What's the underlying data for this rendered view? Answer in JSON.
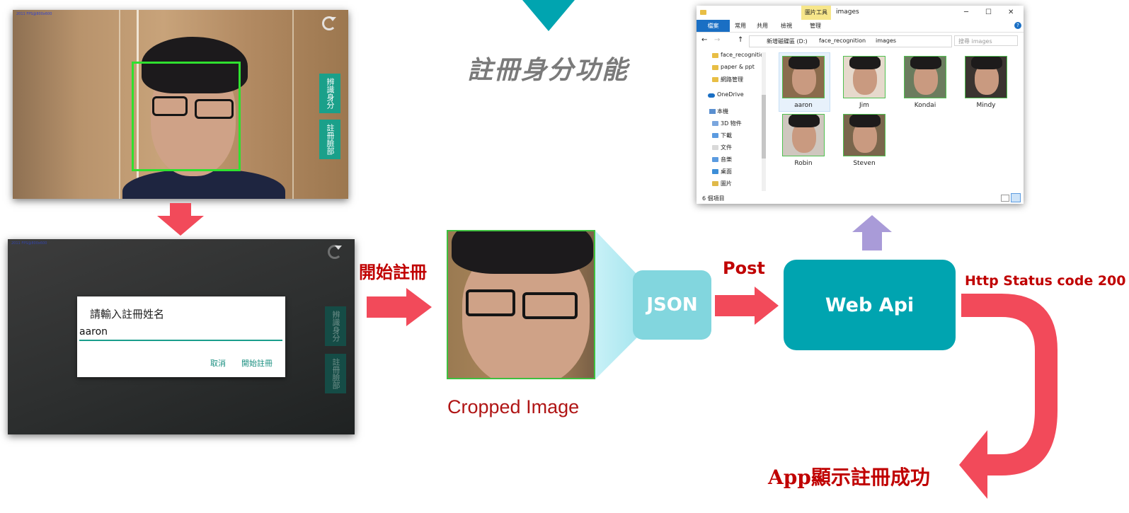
{
  "title": "註冊身分功能",
  "camera_view": {
    "overlay_text": "2011 FPS@800x600",
    "side_buttons": [
      "辨識身分",
      "註冊臉部"
    ]
  },
  "register_dialog": {
    "overlay_text": "2011 FPS@800x600",
    "title": "請輸入註冊姓名",
    "input_value": "aaron",
    "cancel_label": "取消",
    "confirm_label": "開始註冊",
    "side_buttons": [
      "辨識身分",
      "註冊臉部"
    ]
  },
  "labels": {
    "start_register": "開始註冊",
    "cropped_image": "Cropped Image",
    "json": "JSON",
    "post": "Post",
    "web_api": "Web Api",
    "http_status": "Http Status code 200",
    "app_success": "App顯示註冊成功"
  },
  "explorer": {
    "window_title": "images",
    "tool_tab": "圖片工具",
    "ribbon_tabs": [
      "檔案",
      "常用",
      "共用",
      "檢視",
      "管理"
    ],
    "address_parts": [
      "新增磁碟區 (D:)",
      "face_recognition",
      "images"
    ],
    "search_placeholder": "搜尋 images",
    "nav_items": [
      {
        "label": "face_recognitio",
        "icon": "folder-icon"
      },
      {
        "label": "paper & ppt",
        "icon": "folder-icon"
      },
      {
        "label": "網路管理",
        "icon": "folder-icon"
      },
      {
        "label": "OneDrive",
        "icon": "cloud-icon"
      },
      {
        "label": "本機",
        "icon": "computer-icon"
      },
      {
        "label": "3D 物件",
        "icon": "folder-icon"
      },
      {
        "label": "下載",
        "icon": "folder-icon"
      },
      {
        "label": "文件",
        "icon": "folder-icon"
      },
      {
        "label": "音樂",
        "icon": "folder-icon"
      },
      {
        "label": "桌面",
        "icon": "folder-icon"
      },
      {
        "label": "圖片",
        "icon": "folder-icon"
      }
    ],
    "files": [
      "aaron",
      "Jim",
      "Kondai",
      "Mindy",
      "Robin",
      "Steven"
    ],
    "status_text": "6 個項目"
  },
  "colors": {
    "arrow_red": "#f24a5a",
    "arrow_purple": "#a99bd8",
    "teal_dark": "#00a4b0",
    "teal_light": "#82d6de",
    "label_red": "#c00000"
  }
}
